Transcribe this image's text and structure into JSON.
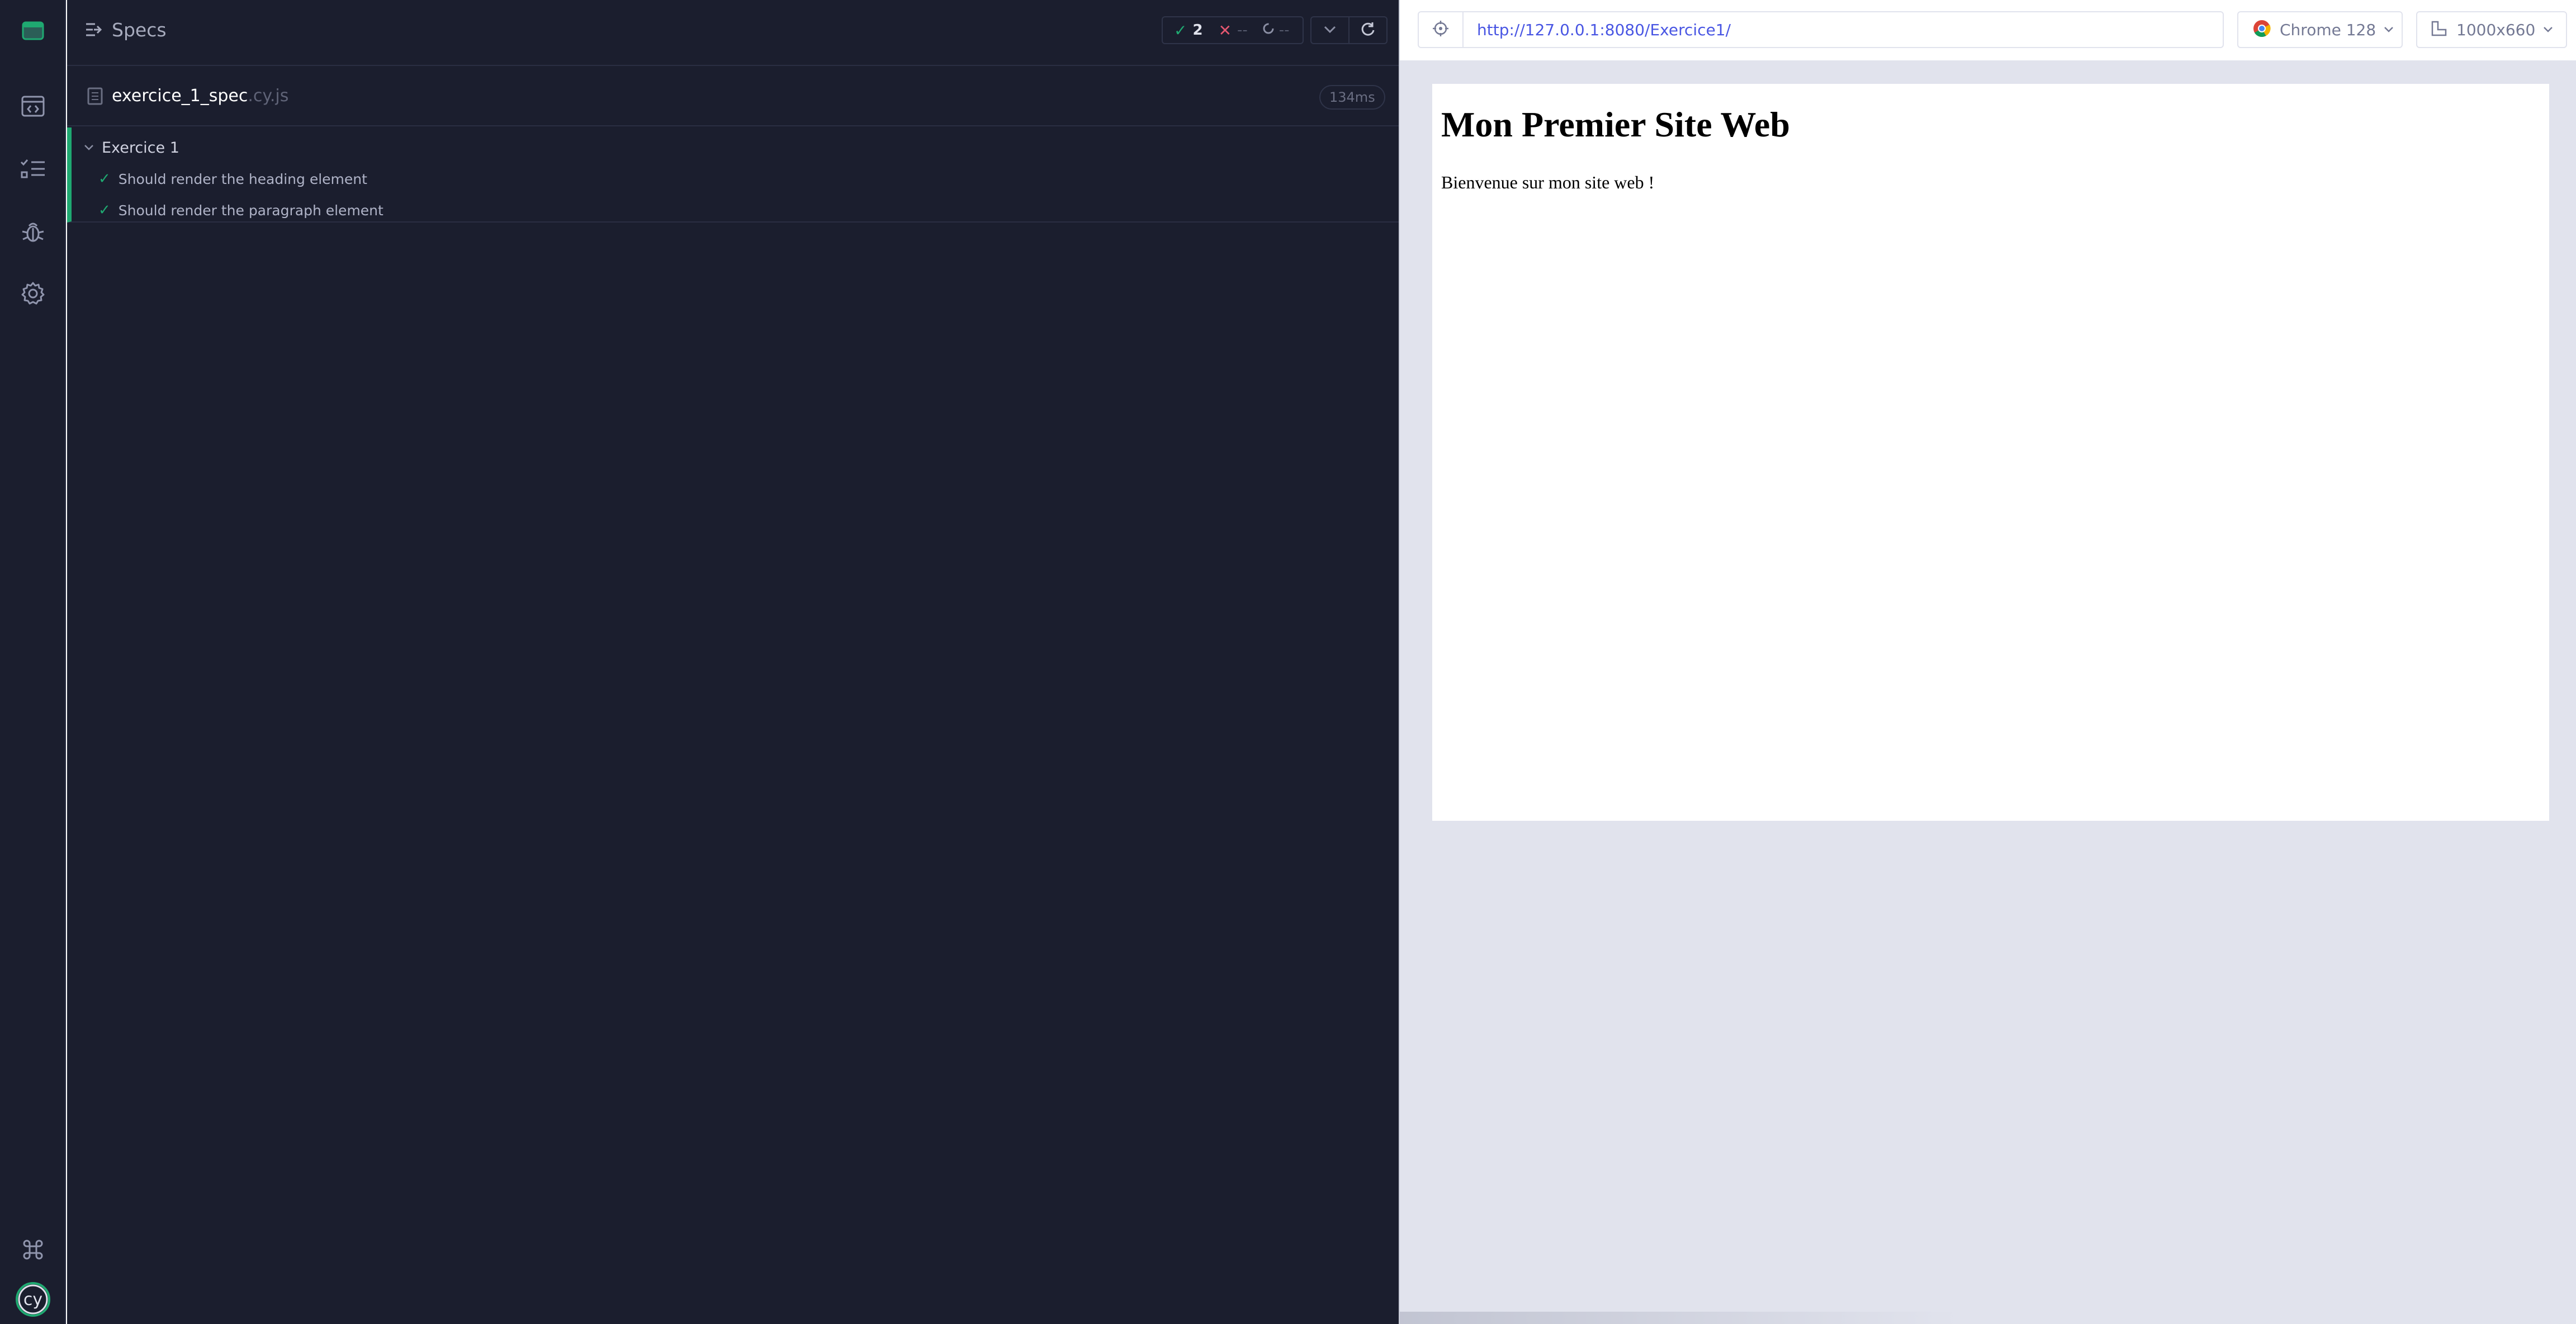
{
  "nav": {
    "items": [
      {
        "name": "specs",
        "icon": "code-window-icon"
      },
      {
        "name": "runs",
        "icon": "checklist-icon"
      },
      {
        "name": "debug",
        "icon": "bug-icon"
      },
      {
        "name": "settings",
        "icon": "gear-icon"
      }
    ],
    "bottom": [
      {
        "name": "keyboard-shortcuts",
        "icon": "command-key-icon"
      },
      {
        "name": "cypress-logo",
        "icon": "cy-logo-icon",
        "text": "cy"
      }
    ]
  },
  "reporter": {
    "header_title": "Specs",
    "stats": {
      "passed": "2",
      "failed": "--",
      "pending": "--"
    },
    "spec_file": {
      "name": "exercice_1_spec",
      "ext": ".cy.js",
      "duration": "134ms"
    },
    "suite": {
      "title": "Exercice 1",
      "tests": [
        {
          "title": "Should render the heading element",
          "state": "passed"
        },
        {
          "title": "Should render the paragraph element",
          "state": "passed"
        }
      ]
    }
  },
  "aut": {
    "url": "http://127.0.0.1:8080/Exercice1/",
    "browser": "Chrome 128",
    "viewport": "1000x660",
    "page": {
      "heading": "Mon Premier Site Web",
      "paragraph": "Bienvenue sur mon site web !"
    }
  },
  "colors": {
    "bg_dark": "#1b1e2e",
    "passed": "#1fa971",
    "failed": "#e45770",
    "url": "#4956e3",
    "aut_bg": "#e1e3ed"
  }
}
